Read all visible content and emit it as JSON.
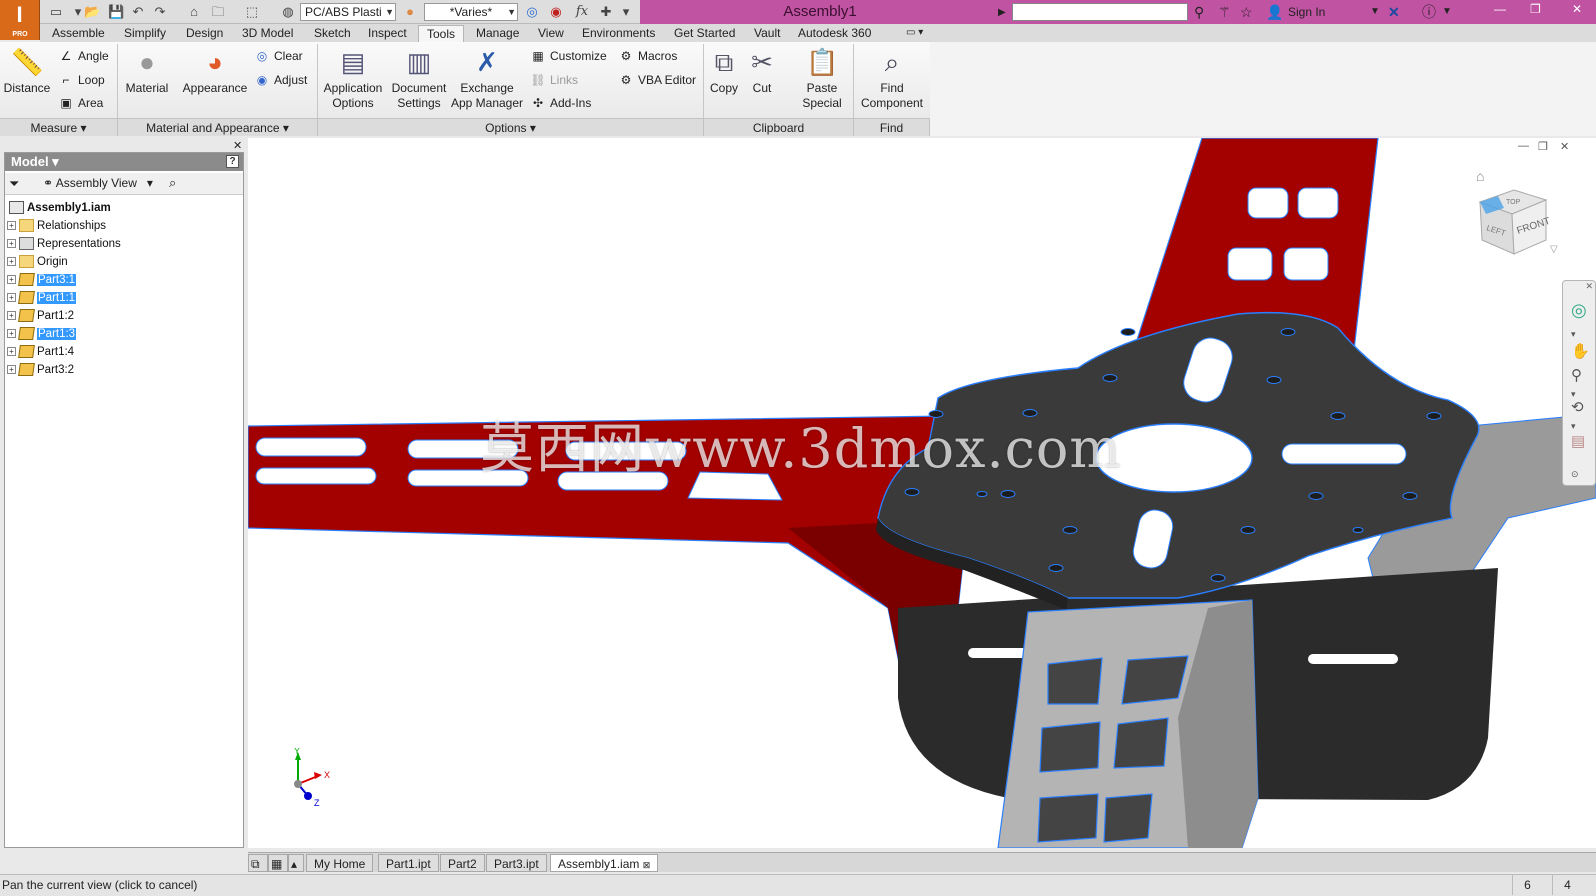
{
  "app": {
    "title": "Assembly1",
    "logo_letter": "I",
    "logo_badge": "PRO",
    "material_combo": "PC/ABS Plasti",
    "appearance_combo": "*Varies*",
    "fx_label": "fx",
    "sign_in": "Sign In",
    "accent_color": "#c153a3"
  },
  "tabs": [
    "Assemble",
    "Simplify",
    "Design",
    "3D Model",
    "Sketch",
    "Inspect",
    "Tools",
    "Manage",
    "View",
    "Environments",
    "Get Started",
    "Vault",
    "Autodesk 360"
  ],
  "active_tab": "Tools",
  "ribbon": {
    "measure": {
      "distance": "Distance",
      "angle": "Angle",
      "loop": "Loop",
      "area": "Area",
      "panel": "Measure"
    },
    "material_appearance": {
      "material": "Material",
      "appearance": "Appearance",
      "clear": "Clear",
      "adjust": "Adjust",
      "panel": "Material and Appearance"
    },
    "options": {
      "app_options_1": "Application",
      "app_options_2": "Options",
      "doc_settings_1": "Document",
      "doc_settings_2": "Settings",
      "exchange_1": "Exchange",
      "exchange_2": "App Manager",
      "customize": "Customize",
      "links": "Links",
      "add_ins": "Add-Ins",
      "macros": "Macros",
      "vba_editor": "VBA Editor",
      "panel": "Options"
    },
    "clipboard": {
      "copy": "Copy",
      "cut": "Cut",
      "paste_1": "Paste",
      "paste_2": "Special",
      "panel": "Clipboard"
    },
    "find": {
      "find_1": "Find",
      "find_2": "Component",
      "panel": "Find"
    }
  },
  "browser": {
    "header": "Model",
    "help": "?",
    "view": "Assembly View",
    "root": "Assembly1.iam",
    "nodes": [
      {
        "label": "Relationships",
        "selected": false
      },
      {
        "label": "Representations",
        "selected": false
      },
      {
        "label": "Origin",
        "selected": false
      },
      {
        "label": "Part3:1",
        "selected": true
      },
      {
        "label": "Part1:1",
        "selected": true
      },
      {
        "label": "Part1:2",
        "selected": false
      },
      {
        "label": "Part1:3",
        "selected": true
      },
      {
        "label": "Part1:4",
        "selected": false
      },
      {
        "label": "Part3:2",
        "selected": false
      }
    ]
  },
  "viewcube": {
    "top": "TOP",
    "left": "LEFT",
    "front": "FRONT"
  },
  "triad": {
    "x": "X",
    "y": "Y",
    "z": "Z"
  },
  "watermark": "莫西网www.3dmox.com",
  "doc_tabs": [
    "My Home",
    "Part1.ipt",
    "Part2",
    "Part3.ipt",
    "Assembly1.iam"
  ],
  "active_doc": "Assembly1.iam",
  "status": {
    "message": "Pan the current view (click to cancel)",
    "count_a": "6",
    "count_b": "4"
  },
  "colors": {
    "arm_red": "#a00000",
    "plate_dark": "#3a3a3a",
    "arm_gray": "#b4b4b4",
    "edge_blue": "#2a7fff"
  }
}
